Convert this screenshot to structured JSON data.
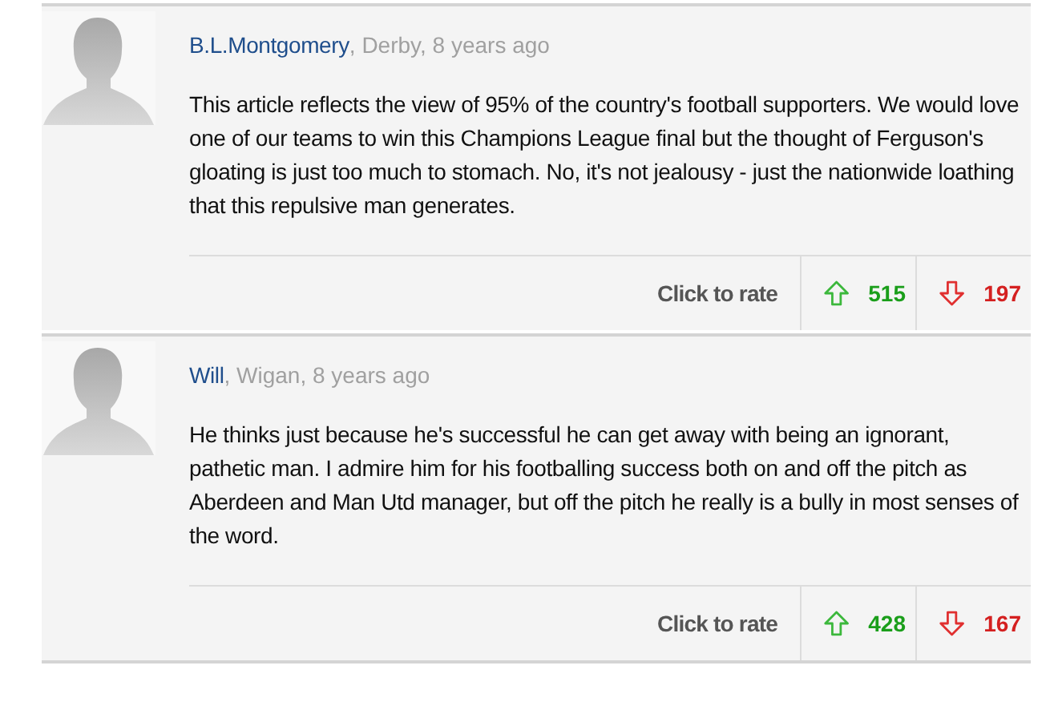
{
  "comments": [
    {
      "author": "B.L.Montgomery",
      "meta": ", Derby, 8 years ago",
      "body": "This article reflects the view of 95% of the country's football supporters. We would love one of our teams to win this Champions League final but the thought of Ferguson's gloating is just too much to stomach. No, it's not jealousy - just the nationwide loathing that this repulsive man generates.",
      "rate_label": "Click to rate",
      "up": "515",
      "down": "197"
    },
    {
      "author": "Will",
      "meta": ", Wigan, 8 years ago",
      "body": "He thinks just because he's successful he can get away with being an ignorant, pathetic man. I admire him for his footballing success both on and off the pitch as Aberdeen and Man Utd manager, but off the pitch he really is a bully in most senses of the word.",
      "rate_label": "Click to rate",
      "up": "428",
      "down": "167"
    }
  ]
}
